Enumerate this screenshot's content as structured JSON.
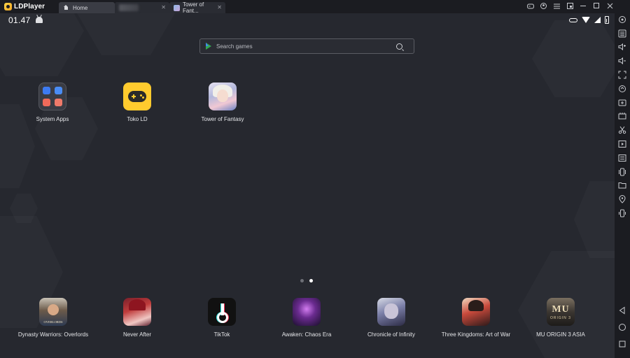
{
  "titlebar": {
    "logo_text": "LDPlayer",
    "tabs": [
      {
        "label": "Home",
        "active": true
      },
      {
        "label": "",
        "blurred": true
      },
      {
        "label": "Tower of Fant..."
      }
    ],
    "close_glyph": "✕",
    "window_controls": [
      "gamepad-icon",
      "user-icon",
      "menu-icon",
      "restore-window-icon",
      "minimize-icon",
      "maximize-icon",
      "close-icon",
      "collapse-sidebar-icon"
    ]
  },
  "statusbar": {
    "time": "01.47",
    "icons": [
      "android-icon",
      "key-icon",
      "wifi-icon",
      "signal-icon",
      "battery-icon"
    ]
  },
  "search": {
    "placeholder": "Search games"
  },
  "desktop_apps": [
    {
      "label": "System Apps"
    },
    {
      "label": "Toko LD"
    },
    {
      "label": "Tower of Fantasy"
    }
  ],
  "dock_apps": [
    {
      "label": "Dynasty Warriors: Overlords",
      "badge": "OVERLORDS"
    },
    {
      "label": "Never After"
    },
    {
      "label": "TikTok"
    },
    {
      "label": "Awaken: Chaos Era"
    },
    {
      "label": "Chronicle of Infinity"
    },
    {
      "label": "Three Kingdoms: Art of War"
    },
    {
      "label": "MU ORIGIN 3 ASIA",
      "badge_title": "MU",
      "badge_sub": "ORIGIN 3"
    }
  ],
  "pager": {
    "pages": 2,
    "current": 2
  },
  "sidebar_tools": [
    "settings-icon",
    "keyboard-mapping-icon",
    "volume-up-icon",
    "volume-down-icon",
    "fullscreen-icon",
    "sync-icon",
    "install-apk-icon",
    "multi-instance-icon",
    "screenshot-cut-icon",
    "record-icon",
    "operation-record-icon",
    "shake-icon",
    "folder-icon",
    "location-icon",
    "rotate-icon",
    "back-icon",
    "home-icon",
    "recents-icon"
  ],
  "colors": {
    "background": "#26282f",
    "titlebar": "#1b1c21",
    "accent_yellow": "#ffcb2e"
  }
}
